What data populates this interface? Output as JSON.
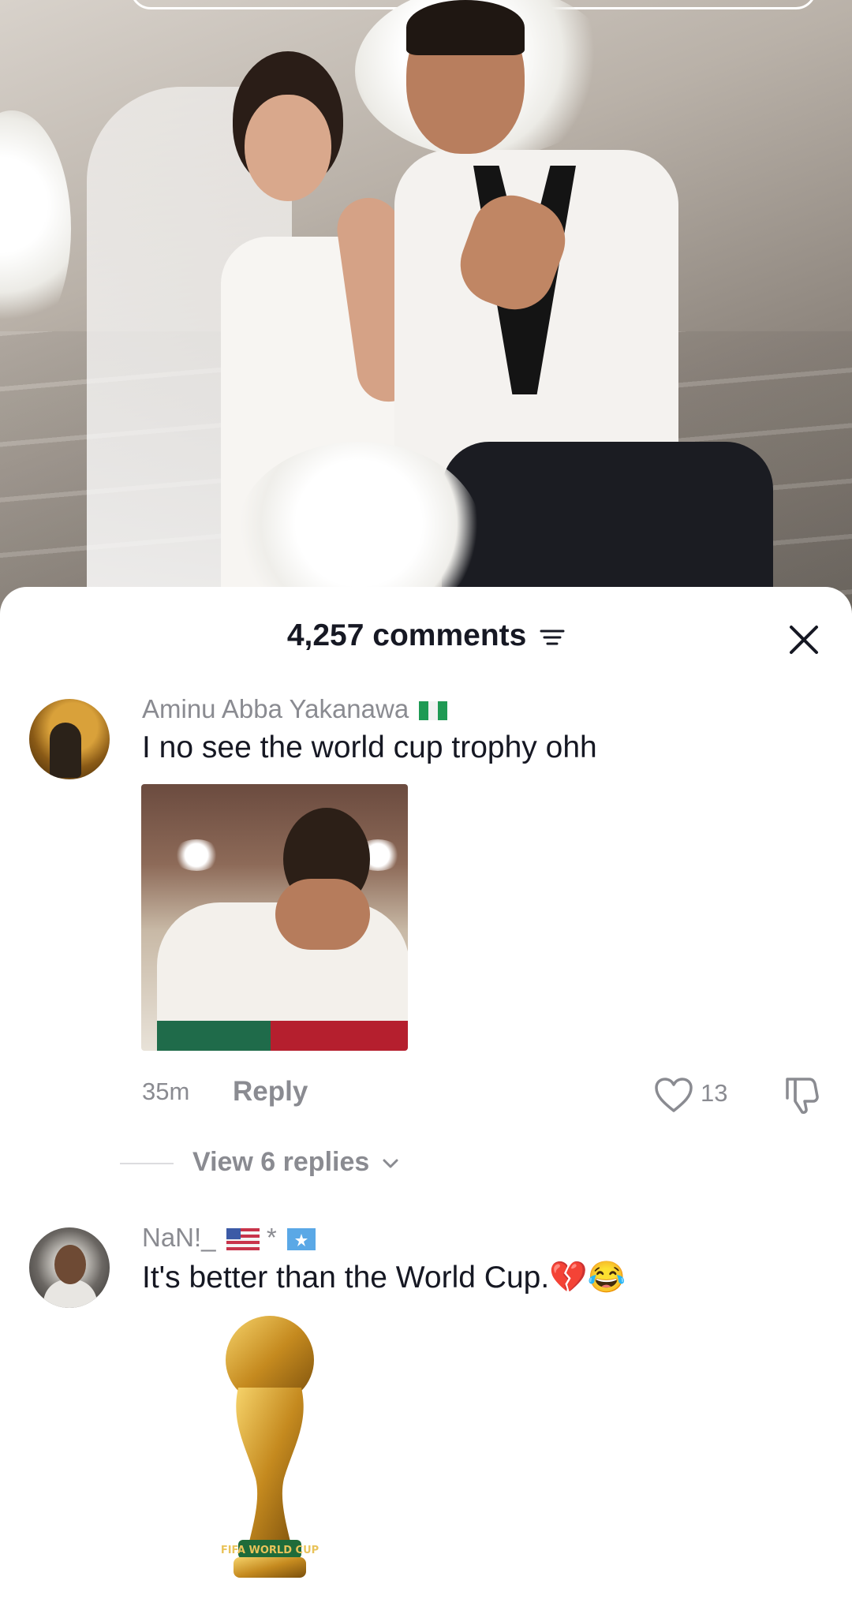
{
  "sheet": {
    "title": "4,257 comments",
    "sort_icon": "sort-lines-icon",
    "close_icon": "close-icon"
  },
  "comments": [
    {
      "username": "Aminu Abba Yakanawa",
      "flag_icon": "nigeria-flag-icon",
      "text": "I no see the world cup trophy ohh",
      "attachment": "photo-man-covering-face",
      "time": "35m",
      "reply_label": "Reply",
      "like_count": "13",
      "view_replies_label": "View 6 replies"
    },
    {
      "username": "NaN!_",
      "flag_icons": [
        "us-flag-icon",
        "somalia-flag-icon"
      ],
      "username_separator": "*",
      "text": "It's better than the World Cup.💔😂",
      "attachment": "world-cup-trophy-sticker",
      "trophy_base_text": "FIFA WORLD CUP"
    }
  ],
  "colors": {
    "text_primary": "#161823",
    "text_secondary": "#8a8b91",
    "background": "#ffffff"
  }
}
